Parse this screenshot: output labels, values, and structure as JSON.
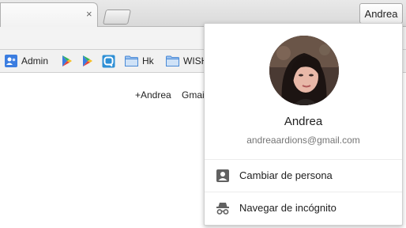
{
  "browser": {
    "close_tab_glyph": "×",
    "profile_button_label": "Andrea"
  },
  "bookmarks": [
    {
      "label": "Admin",
      "icon": "admin-app-icon"
    },
    {
      "label": "",
      "icon": "google-play-icon"
    },
    {
      "label": "",
      "icon": "google-play-icon"
    },
    {
      "label": "",
      "icon": "app-chat-icon"
    },
    {
      "label": "Hk",
      "icon": "folder-icon"
    },
    {
      "label": "WISH",
      "icon": "folder-icon"
    }
  ],
  "page": {
    "links": [
      "+Andrea",
      "Gmail"
    ]
  },
  "profile_popup": {
    "name": "Andrea",
    "email": "andreaardions@gmail.com",
    "menu": [
      {
        "label": "Cambiar de persona",
        "icon": "person-icon"
      },
      {
        "label": "Navegar de incógnito",
        "icon": "incognito-icon"
      }
    ]
  },
  "colors": {
    "folder": "#4a8ad6",
    "play_blue": "#3b7de0",
    "play_green": "#2fb35a",
    "play_red": "#e8453c",
    "play_yellow": "#f6c026",
    "menu_icon": "#616161"
  }
}
